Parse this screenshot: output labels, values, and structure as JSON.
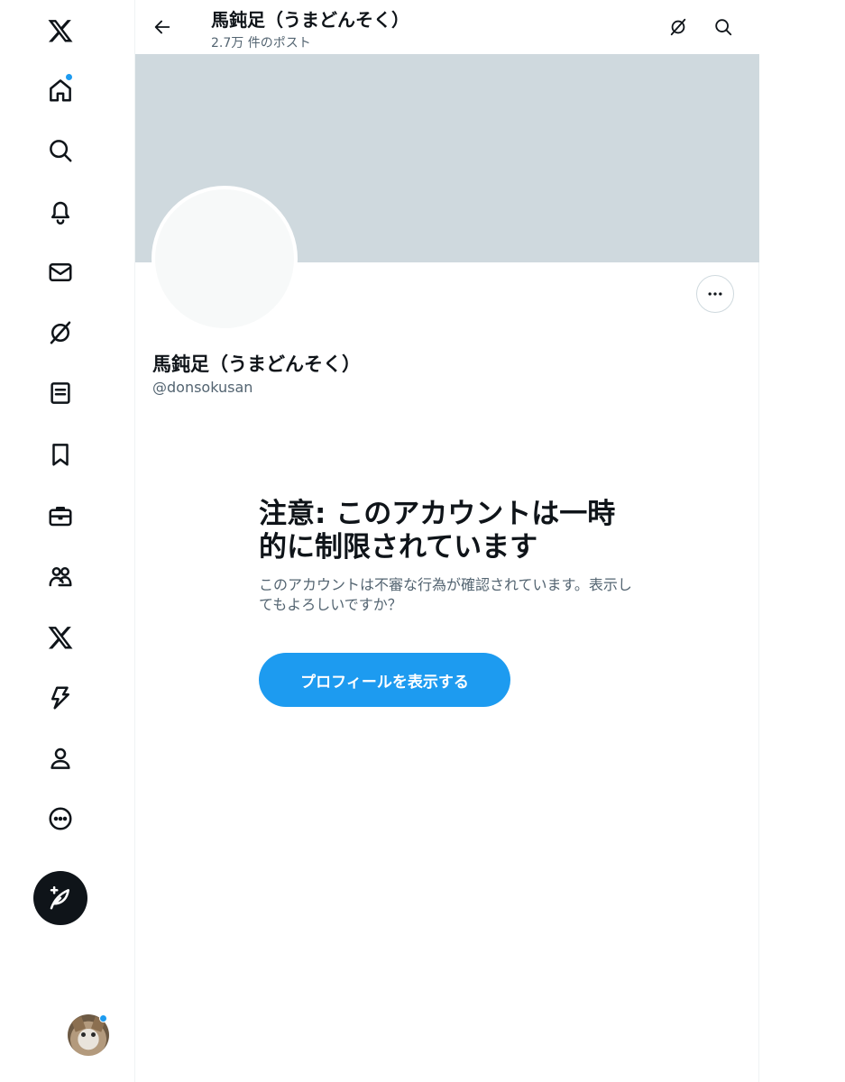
{
  "nav": {
    "items": [
      {
        "name": "x-logo-icon"
      },
      {
        "name": "home-icon"
      },
      {
        "name": "search-icon"
      },
      {
        "name": "bell-icon"
      },
      {
        "name": "mail-icon"
      },
      {
        "name": "grok-icon"
      },
      {
        "name": "lists-icon"
      },
      {
        "name": "bookmark-icon"
      },
      {
        "name": "jobs-icon"
      },
      {
        "name": "communities-icon"
      },
      {
        "name": "premium-x-icon"
      },
      {
        "name": "verified-orgs-icon"
      },
      {
        "name": "profile-icon"
      },
      {
        "name": "more-circle-icon"
      }
    ],
    "compose_icon": "compose-feather-icon",
    "accent_color": "#1d9bf0"
  },
  "header": {
    "title": "馬鈍足（うまどんそく）",
    "subtitle": "2.7万 件のポスト"
  },
  "profile": {
    "name": "馬鈍足（うまどんそく）",
    "handle": "@donsokusan",
    "banner_color": "#cfd9de"
  },
  "warning": {
    "title": "注意: このアカウントは一時的に制限されています",
    "body": "このアカウントは不審な行為が確認されています。表示してもよろしいですか？",
    "button_label": "プロフィールを表示する",
    "button_color": "#1d9bf0"
  }
}
